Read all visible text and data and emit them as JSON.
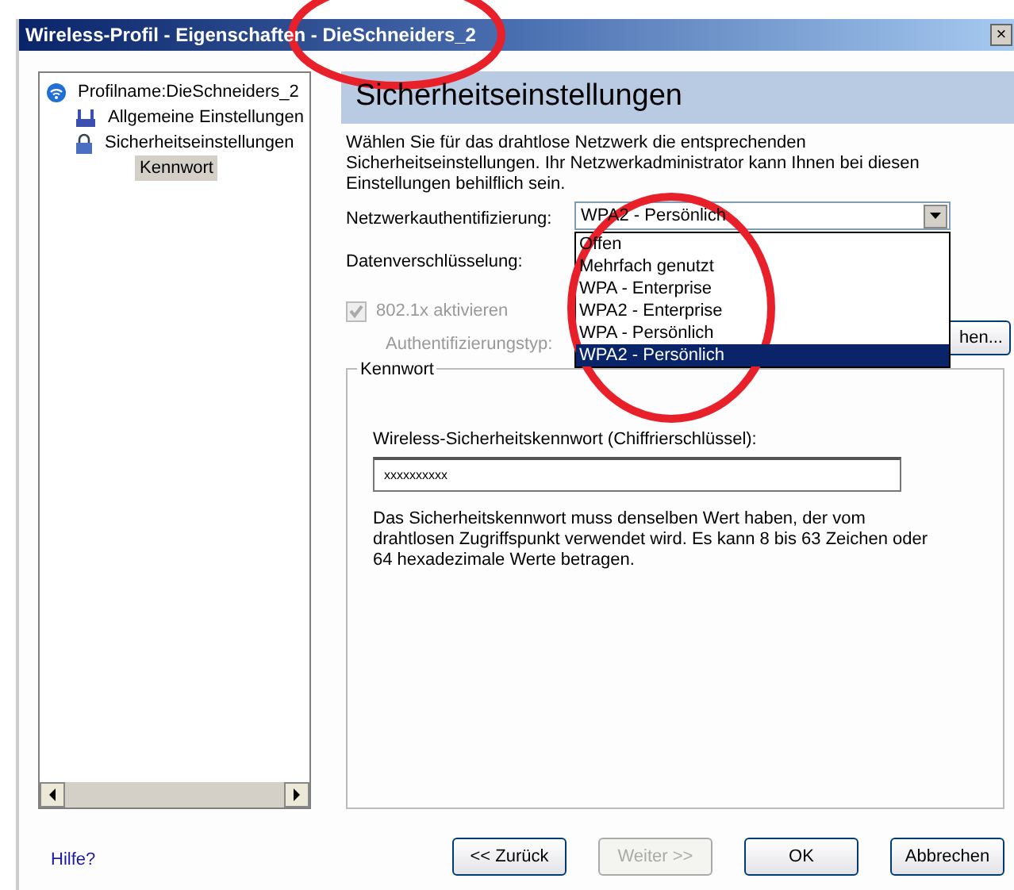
{
  "window": {
    "title": "Wireless-Profil - Eigenschaften - DieSchneiders_2",
    "close": "×"
  },
  "tree": {
    "items": [
      {
        "label": "Profilname:DieSchneiders_2",
        "kind": "wifi",
        "selected": false,
        "children": [
          {
            "label": "Allgemeine Einstellungen",
            "kind": "network",
            "selected": false
          },
          {
            "label": "Sicherheitseinstellungen",
            "kind": "lock",
            "selected": false,
            "children": [
              {
                "label": "Kennwort",
                "selected": true
              }
            ]
          }
        ]
      }
    ]
  },
  "panel": {
    "heading": "Sicherheitseinstellungen",
    "intro": "Wählen Sie für das drahtlose Netzwerk die entsprechenden Sicherheitseinstellungen. Ihr Netzwerkadministrator kann Ihnen bei diesen Einstellungen behilflich sein.",
    "auth": {
      "label": "Netzwerkauthentifizierung:",
      "value": "WPA2 - Persönlich",
      "expanded": true,
      "options": [
        {
          "label": "Offen",
          "selected": false
        },
        {
          "label": "Mehrfach genutzt",
          "selected": false
        },
        {
          "label": "WPA - Enterprise",
          "selected": false
        },
        {
          "label": "WPA2 - Enterprise",
          "selected": false
        },
        {
          "label": "WPA - Persönlich",
          "selected": false
        },
        {
          "label": "WPA2 - Persönlich",
          "selected": true
        }
      ]
    },
    "encryption": {
      "label": "Datenverschlüsselung:"
    },
    "dot1x": {
      "label": "802.1x aktivieren",
      "checked": true,
      "disabled": true
    },
    "auth_type": {
      "label": "Authentifizierungstyp:",
      "button": "hen..."
    },
    "group": {
      "title": "Kennwort",
      "field_label": "Wireless-Sicherheitskennwort (Chiffrierschlüssel):",
      "value": "xxxxxxxxxx",
      "note": "Das Sicherheitskennwort muss denselben Wert haben, der vom drahtlosen Zugriffspunkt verwendet wird. Es kann 8 bis 63 Zeichen oder 64 hexadezimale Werte betragen."
    }
  },
  "help_link": "Hilfe?",
  "buttons": [
    {
      "label": "<< Zurück",
      "disabled": false
    },
    {
      "label": "Weiter >>",
      "disabled": true
    },
    {
      "label": "OK",
      "disabled": false
    },
    {
      "label": "Abbrechen",
      "disabled": false
    }
  ],
  "annotations": [
    {
      "kind": "ellipse"
    },
    {
      "kind": "ellipse"
    }
  ]
}
